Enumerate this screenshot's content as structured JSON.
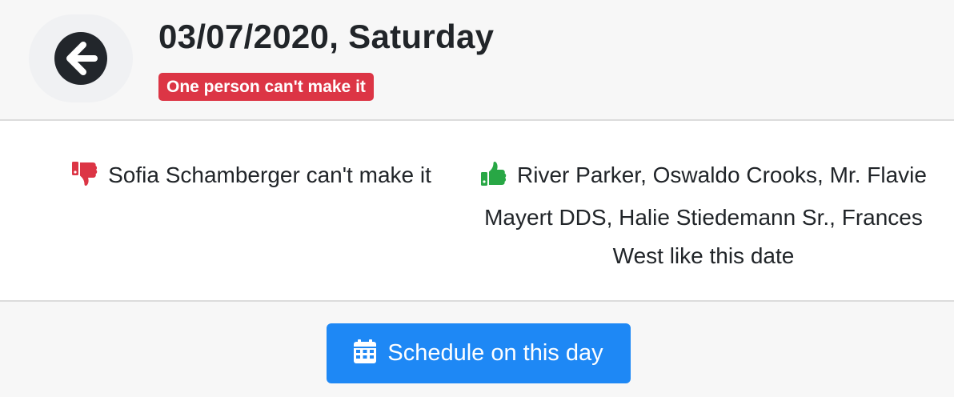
{
  "header": {
    "back_icon": "arrow-left-circle-icon",
    "date_title": "03/07/2020, Saturday",
    "status_badge": "One person can't make it",
    "status_color": "#dc3545"
  },
  "responses": {
    "declined": {
      "icon": "thumbs-down-icon",
      "icon_color": "#dc3545",
      "text": "Sofia Schamberger can't make it"
    },
    "accepted": {
      "icon": "thumbs-up-icon",
      "icon_color": "#28a745",
      "text": "River Parker, Oswaldo Crooks, Mr. Flavie Mayert DDS, Halie Stiedemann Sr., Frances West like this date"
    }
  },
  "footer": {
    "schedule_button_icon": "calendar-icon",
    "schedule_button_label": "Schedule on this day",
    "accent_color": "#1e88f5"
  }
}
